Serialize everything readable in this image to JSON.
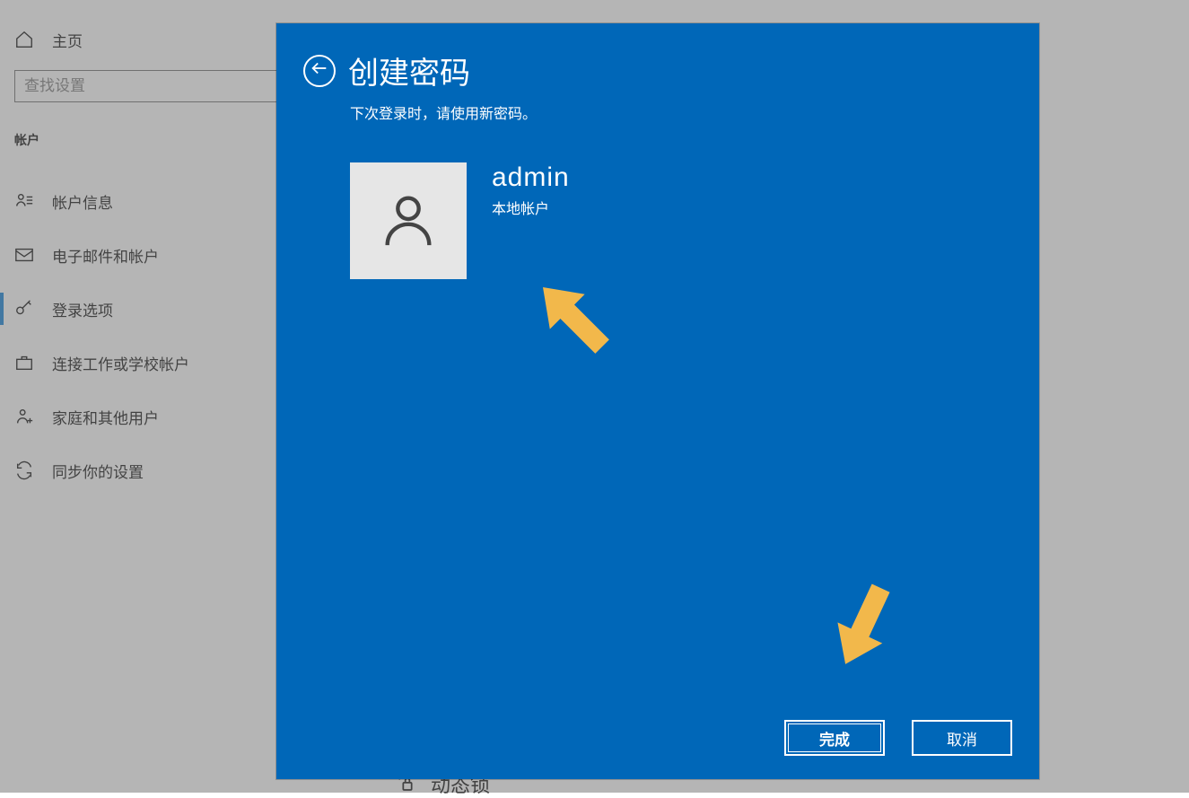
{
  "sidebar": {
    "home_label": "主页",
    "search_placeholder": "查找设置",
    "section_title": "帐户",
    "items": [
      {
        "label": "帐户信息"
      },
      {
        "label": "电子邮件和帐户"
      },
      {
        "label": "登录选项"
      },
      {
        "label": "连接工作或学校帐户"
      },
      {
        "label": "家庭和其他用户"
      },
      {
        "label": "同步你的设置"
      }
    ]
  },
  "main": {
    "peek_label": "动态锁"
  },
  "dialog": {
    "title": "创建密码",
    "subtitle": "下次登录时，请使用新密码。",
    "account_name": "admin",
    "account_type": "本地帐户",
    "finish_label": "完成",
    "cancel_label": "取消"
  }
}
